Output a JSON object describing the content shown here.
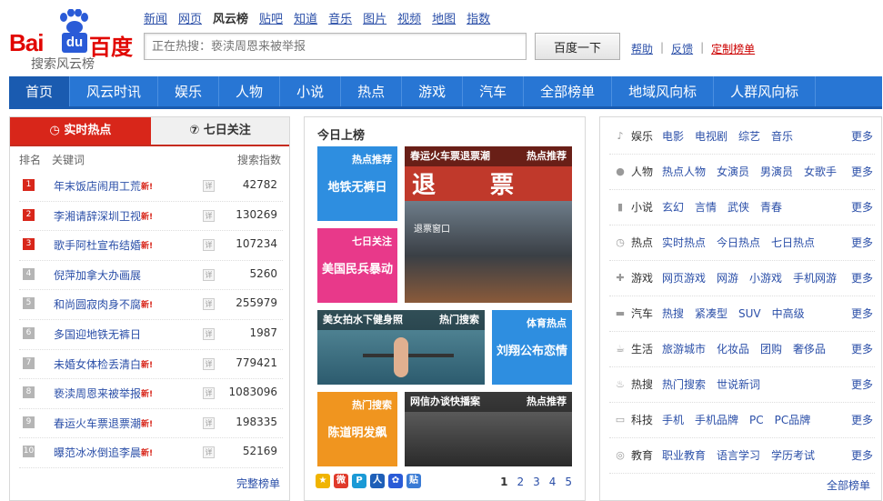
{
  "logo": {
    "bai": "Bai",
    "du": "du",
    "baidu_cn": "百度",
    "subtitle": "搜索风云榜"
  },
  "topnav": [
    "新闻",
    "网页",
    "风云榜",
    "贴吧",
    "知道",
    "音乐",
    "图片",
    "视频",
    "地图",
    "指数"
  ],
  "topnav_current": "风云榜",
  "search": {
    "placeholder": "正在热搜：亵渎周恩来被举报",
    "button": "百度一下"
  },
  "toplinks": {
    "help": "帮助",
    "feedback": "反馈",
    "custom": "定制榜单",
    "sep": "|"
  },
  "mainnav": [
    "首页",
    "风云时讯",
    "娱乐",
    "人物",
    "小说",
    "热点",
    "游戏",
    "汽车",
    "全部榜单",
    "地域风向标",
    "人群风向标"
  ],
  "left": {
    "tab_realtime": "实时热点",
    "tab_week": "七日关注",
    "head_rank": "排名",
    "head_keyword": "关键词",
    "head_index": "搜索指数",
    "new_label": "新!",
    "rows": [
      {
        "rank": "1",
        "keyword": "年末饭店闹用工荒",
        "index": "42782"
      },
      {
        "rank": "2",
        "keyword": "李湘请辞深圳卫视",
        "index": "130269"
      },
      {
        "rank": "3",
        "keyword": "歌手阿杜宣布结婚",
        "index": "107234"
      },
      {
        "rank": "4",
        "keyword": "倪萍加拿大办画展",
        "index": "5260"
      },
      {
        "rank": "5",
        "keyword": "和尚圆寂肉身不腐",
        "index": "255979"
      },
      {
        "rank": "6",
        "keyword": "多国迎地铁无裤日",
        "index": "1987"
      },
      {
        "rank": "7",
        "keyword": "未婚女体检丢清白",
        "index": "779421"
      },
      {
        "rank": "8",
        "keyword": "亵渎周恩来被举报",
        "index": "1083096"
      },
      {
        "rank": "9",
        "keyword": "春运火车票退票潮",
        "index": "198335"
      },
      {
        "rank": "10",
        "keyword": "曝范冰冰倒追李晨",
        "index": "52169"
      }
    ],
    "more": "完整榜单"
  },
  "mid": {
    "title": "今日上榜",
    "tiles": [
      {
        "tag": "热点推荐",
        "text": "地铁无裤日"
      },
      {
        "tag": "七日关注",
        "text": "美国民兵暴动"
      },
      {
        "tag": "体育热点",
        "text": "刘翔公布恋情"
      },
      {
        "tag": "热门搜索",
        "text": "陈道明发飙"
      }
    ],
    "photos": [
      {
        "caption": "春运火车票退票潮",
        "tag": "热点推荐",
        "sign": "退票",
        "sign2": "退票窗口"
      },
      {
        "caption": "美女拍水下健身照",
        "tag": "热门搜索"
      },
      {
        "caption": "网信办谈快播案",
        "tag": "热点推荐"
      }
    ],
    "pages": [
      "1",
      "2",
      "3",
      "4",
      "5"
    ]
  },
  "right": {
    "more": "更多",
    "all": "全部榜单",
    "cats": [
      {
        "name": "娱乐",
        "links": [
          "电影",
          "电视剧",
          "综艺",
          "音乐"
        ]
      },
      {
        "name": "人物",
        "links": [
          "热点人物",
          "女演员",
          "男演员",
          "女歌手"
        ]
      },
      {
        "name": "小说",
        "links": [
          "玄幻",
          "言情",
          "武侠",
          "青春"
        ]
      },
      {
        "name": "热点",
        "links": [
          "实时热点",
          "今日热点",
          "七日热点"
        ]
      },
      {
        "name": "游戏",
        "links": [
          "网页游戏",
          "网游",
          "小游戏",
          "手机网游"
        ]
      },
      {
        "name": "汽车",
        "links": [
          "热搜",
          "紧凑型",
          "SUV",
          "中高级"
        ]
      },
      {
        "name": "生活",
        "links": [
          "旅游城市",
          "化妆品",
          "团购",
          "奢侈品"
        ]
      },
      {
        "name": "热搜",
        "links": [
          "热门搜索",
          "世说新词"
        ]
      },
      {
        "name": "科技",
        "links": [
          "手机",
          "手机品牌",
          "PC",
          "PC品牌"
        ]
      },
      {
        "name": "教育",
        "links": [
          "职业教育",
          "语言学习",
          "学历考试"
        ]
      }
    ]
  }
}
